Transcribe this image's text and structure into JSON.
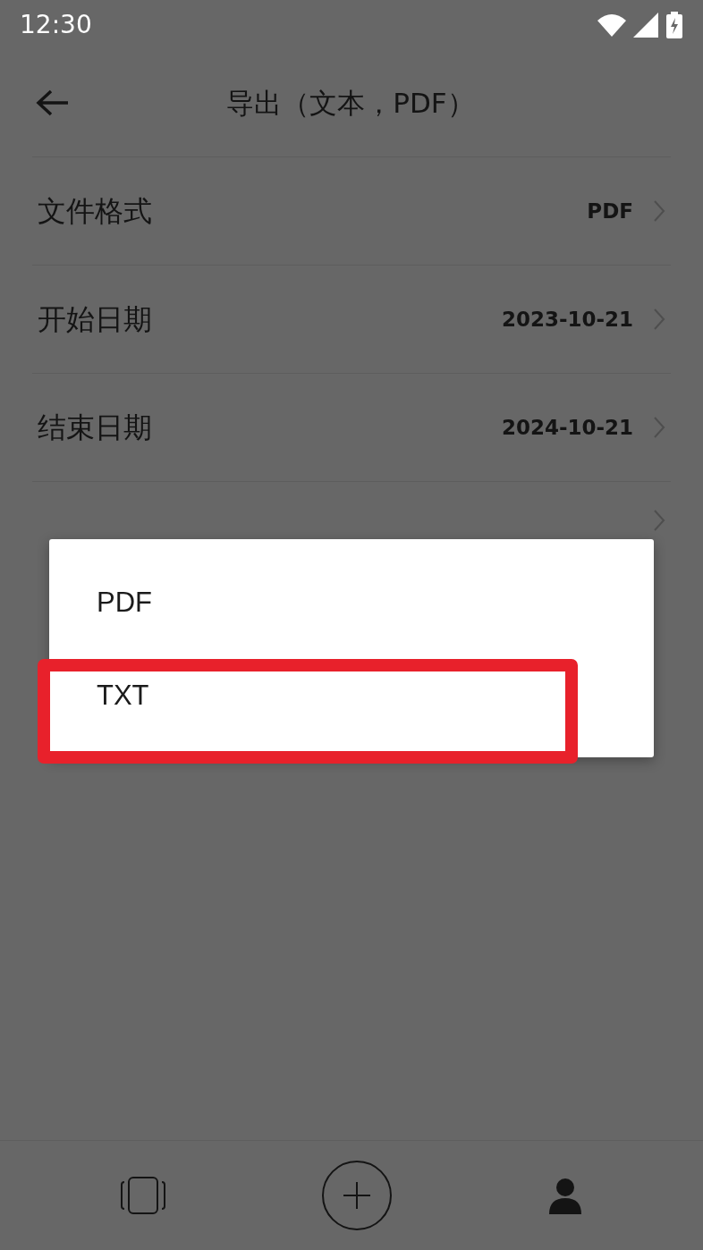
{
  "status_bar": {
    "time": "12:30"
  },
  "header": {
    "title": "导出（文本，PDF）"
  },
  "settings": [
    {
      "label": "文件格式",
      "value": "PDF"
    },
    {
      "label": "开始日期",
      "value": "2023-10-21"
    },
    {
      "label": "结束日期",
      "value": "2024-10-21"
    }
  ],
  "menu": {
    "items": [
      {
        "label": "PDF",
        "highlighted": false
      },
      {
        "label": "TXT",
        "highlighted": true
      }
    ]
  },
  "bottom_nav": [
    {
      "kind": "cards"
    },
    {
      "kind": "add"
    },
    {
      "kind": "profile"
    }
  ]
}
